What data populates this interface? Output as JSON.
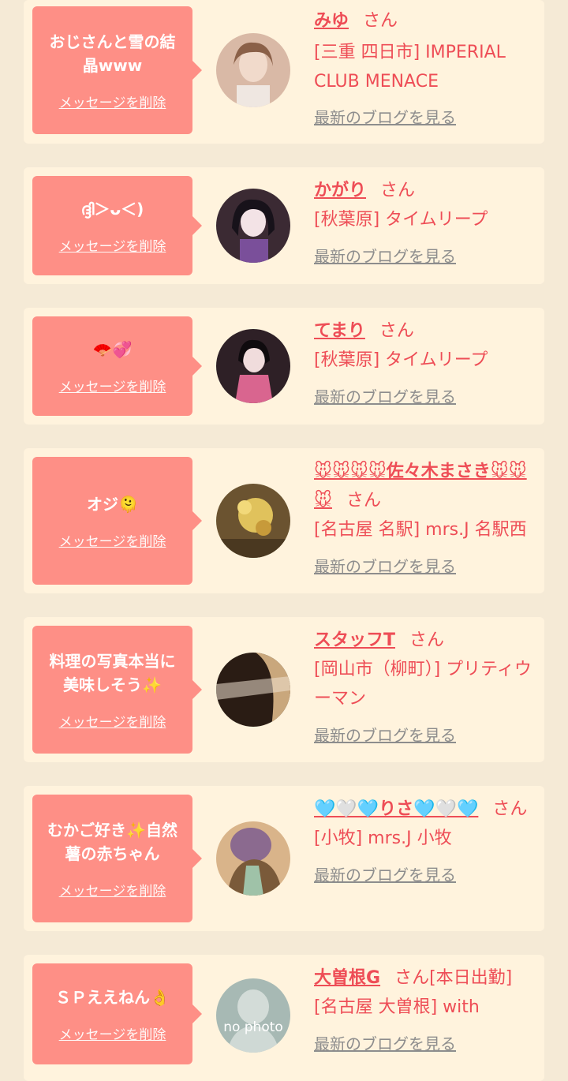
{
  "ui": {
    "delete_label": "メッセージを削除",
    "san": "さん",
    "blog_label": "最新のブログを見る"
  },
  "entries": [
    {
      "message": "おじさんと雪の結晶www",
      "name": "みゆ",
      "suffix": "",
      "shop": "[三重 四日市] IMPERIAL CLUB MENACE",
      "avatar_colors": [
        "#d9b9a6",
        "#8a6048"
      ]
    },
    {
      "message": "ദ്ദി＞ᴗ＜)",
      "name": "かがり",
      "suffix": "",
      "shop": "[秋葉原] タイムリープ",
      "avatar_colors": [
        "#3b2a33",
        "#e8d6e4"
      ]
    },
    {
      "message": "🪭💞",
      "name": "てまり",
      "suffix": "",
      "shop": "[秋葉原] タイムリープ",
      "avatar_colors": [
        "#2e2026",
        "#d9658f"
      ]
    },
    {
      "message": "オジ🫠",
      "name": "🐭🐭🐭🐭佐々木まさき🐭🐭🐭",
      "suffix": "",
      "shop": "[名古屋 名駅] mrs.J 名駅西",
      "avatar_colors": [
        "#6b5330",
        "#e0c25c"
      ]
    },
    {
      "message": "料理の写真本当に美味しそう✨",
      "name": "スタッフT",
      "suffix": "",
      "shop": "[岡山市（柳町）] プリティウーマン",
      "avatar_colors": [
        "#2a1c14",
        "#c9a77c"
      ]
    },
    {
      "message": "むかご好き✨自然薯の赤ちゃん",
      "name": "🩵🤍🩵りさ🩵🤍🩵",
      "suffix": "",
      "shop": "[小牧] mrs.J 小牧",
      "avatar_colors": [
        "#8b6a8f",
        "#d9b48a"
      ]
    },
    {
      "message": "ＳＰええねん👌",
      "name": "大曽根G",
      "suffix": "[本日出勤]",
      "shop": "[名古屋 大曽根] with",
      "avatar_colors": [
        "#a7b9b4",
        "#dfe5e1"
      ],
      "avatar_text": "no photo"
    }
  ]
}
